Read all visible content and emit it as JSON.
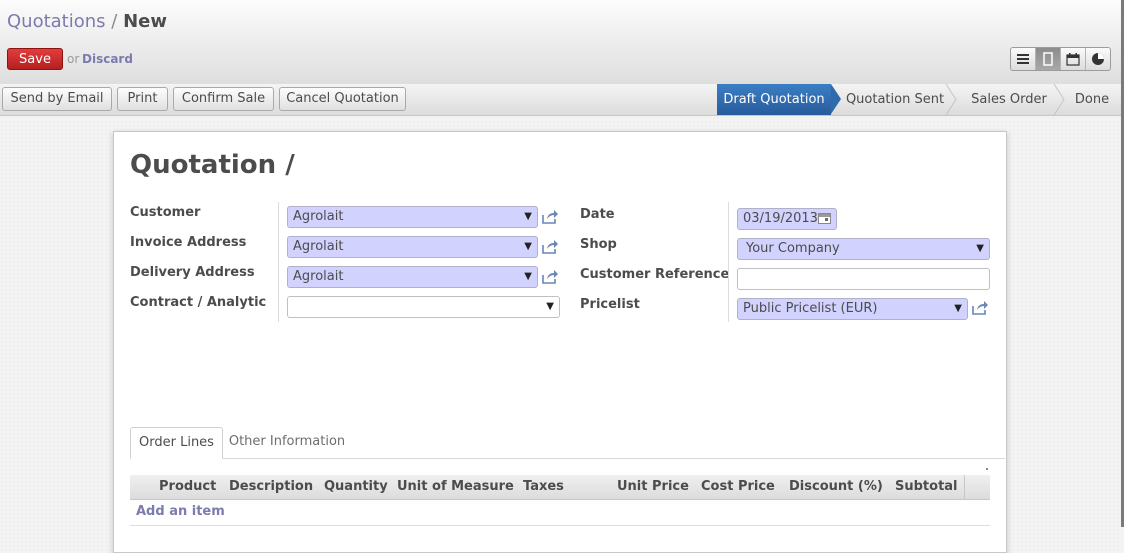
{
  "header": {
    "breadcrumb": {
      "parent": "Quotations",
      "separator": "/",
      "current": "New"
    },
    "save_label": "Save",
    "or_text": "or",
    "discard_label": "Discard",
    "view_modes": [
      "list-icon",
      "form-icon",
      "calendar-icon",
      "graph-icon"
    ],
    "active_view": "form-icon"
  },
  "toolbar": {
    "buttons": [
      "Send by Email",
      "Print",
      "Confirm Sale",
      "Cancel Quotation"
    ],
    "stages": [
      "Draft Quotation",
      "Quotation Sent",
      "Sales Order",
      "Done"
    ],
    "active_stage": "Draft Quotation"
  },
  "form": {
    "title": "Quotation /",
    "left_fields": [
      {
        "label": "Customer",
        "value": "Agrolait"
      },
      {
        "label": "Invoice Address",
        "value": "Agrolait"
      },
      {
        "label": "Delivery Address",
        "value": "Agrolait"
      },
      {
        "label": "Contract / Analytic",
        "value": ""
      }
    ],
    "right_fields": [
      {
        "label": "Date",
        "value": "03/19/2013"
      },
      {
        "label": "Shop",
        "value": "Your Company"
      },
      {
        "label": "Customer Reference",
        "value": ""
      },
      {
        "label": "Pricelist",
        "value": "Public Pricelist (EUR)"
      }
    ]
  },
  "notebook": {
    "tabs": [
      "Order Lines",
      "Other Information"
    ],
    "active_tab": "Order Lines",
    "columns": [
      "Product",
      "Description",
      "Quantity",
      "Unit of Measure",
      "Taxes",
      "Unit Price",
      "Cost Price",
      "Discount (%)",
      "Subtotal"
    ],
    "add_item_label": "Add an item"
  },
  "colors": {
    "accent": "#7c7bad",
    "save_red": "#c62a2a",
    "active_stage_blue": "#3373b8",
    "required_field": "#d2d2ff"
  }
}
